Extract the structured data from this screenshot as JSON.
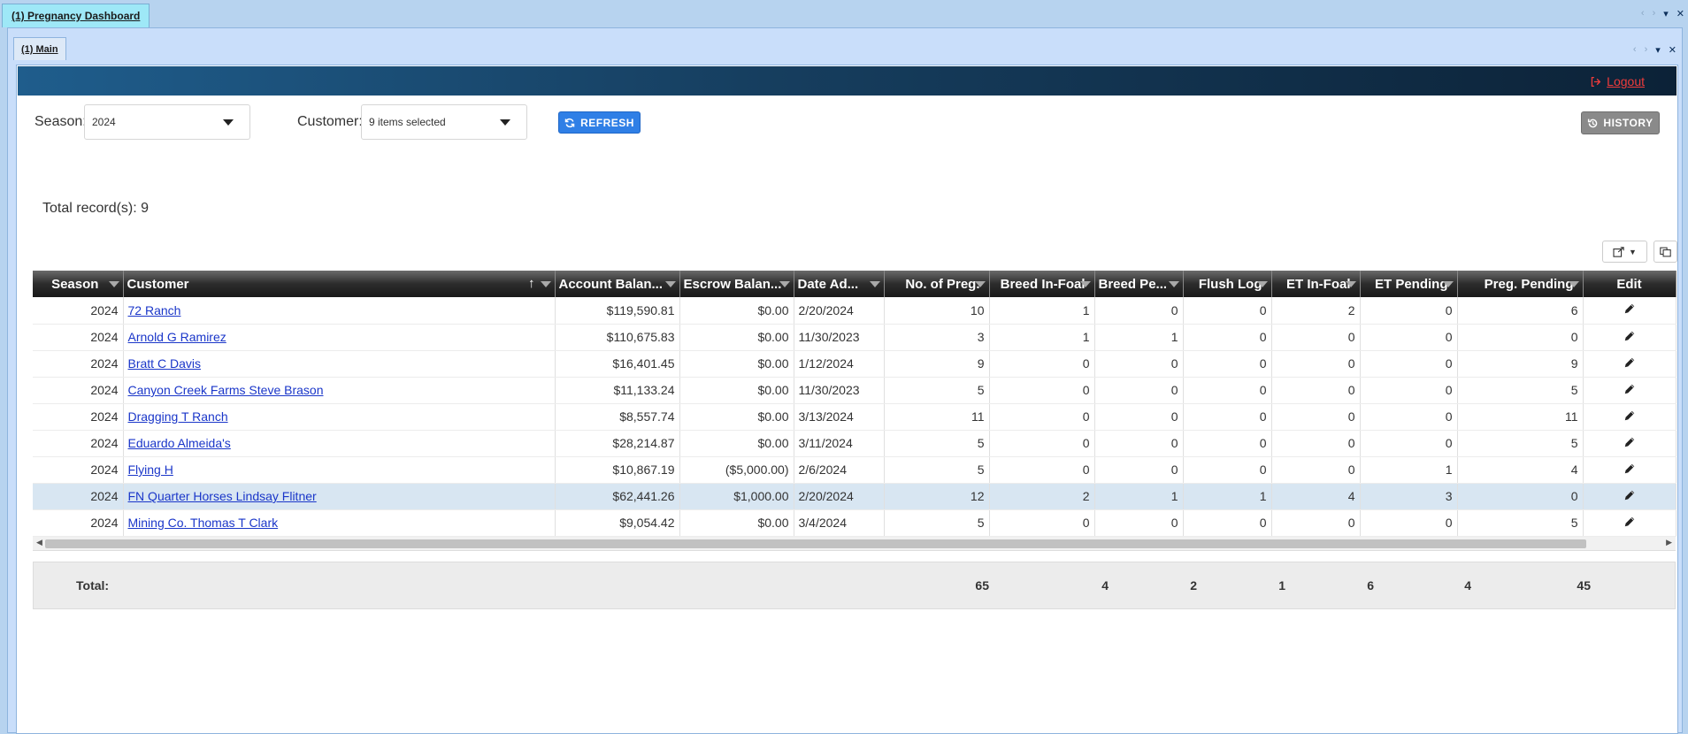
{
  "outer_tab": {
    "label": "(1) Pregnancy Dashboard"
  },
  "inner_tab": {
    "label": "(1) Main"
  },
  "window_controls": {
    "prev": "‹",
    "next": "›",
    "menu": "▾",
    "close": "✕"
  },
  "header": {
    "logout_label": "Logout"
  },
  "filters": {
    "season_label": "Season:",
    "season_value": "2024",
    "customer_label": "Customer:",
    "customer_value": "9 items selected",
    "refresh_label": "REFRESH",
    "history_label": "HISTORY"
  },
  "summary": {
    "total_records": "Total record(s): 9"
  },
  "table": {
    "columns": [
      "Season",
      "Customer",
      "Account Balan...",
      "Escrow Balan...",
      "Date Ad...",
      "No. of Preg.",
      "Breed In-Foal",
      "Breed Pe...",
      "Flush Log",
      "ET In-Foal",
      "ET Pending",
      "Preg. Pending",
      "Edit"
    ],
    "rows": [
      [
        "2024",
        "72 Ranch",
        "$119,590.81",
        "$0.00",
        "2/20/2024",
        "10",
        "1",
        "0",
        "0",
        "2",
        "0",
        "6"
      ],
      [
        "2024",
        "Arnold G Ramirez",
        "$110,675.83",
        "$0.00",
        "11/30/2023",
        "3",
        "1",
        "1",
        "0",
        "0",
        "0",
        "0"
      ],
      [
        "2024",
        "Bratt C Davis",
        "$16,401.45",
        "$0.00",
        "1/12/2024",
        "9",
        "0",
        "0",
        "0",
        "0",
        "0",
        "9"
      ],
      [
        "2024",
        "Canyon Creek Farms Steve Brason",
        "$11,133.24",
        "$0.00",
        "11/30/2023",
        "5",
        "0",
        "0",
        "0",
        "0",
        "0",
        "5"
      ],
      [
        "2024",
        "Dragging T Ranch",
        "$8,557.74",
        "$0.00",
        "3/13/2024",
        "11",
        "0",
        "0",
        "0",
        "0",
        "0",
        "11"
      ],
      [
        "2024",
        "Eduardo Almeida's",
        "$28,214.87",
        "$0.00",
        "3/11/2024",
        "5",
        "0",
        "0",
        "0",
        "0",
        "0",
        "5"
      ],
      [
        "2024",
        "Flying H",
        "$10,867.19",
        "($5,000.00)",
        "2/6/2024",
        "5",
        "0",
        "0",
        "0",
        "0",
        "1",
        "4"
      ],
      [
        "2024",
        "FN Quarter Horses Lindsay Flitner",
        "$62,441.26",
        "$1,000.00",
        "2/20/2024",
        "12",
        "2",
        "1",
        "1",
        "4",
        "3",
        "0"
      ],
      [
        "2024",
        "Mining Co. Thomas T Clark",
        "$9,054.42",
        "$0.00",
        "3/4/2024",
        "5",
        "0",
        "0",
        "0",
        "0",
        "0",
        "5"
      ]
    ],
    "selected_row": 7,
    "edit_icon": "pencil-icon"
  },
  "totals": {
    "label": "Total:",
    "preg": "65",
    "breed_in_foal": "4",
    "breed_pending": "2",
    "flush_log": "1",
    "et_in_foal": "6",
    "et_pending": "4",
    "preg_pending": "45"
  },
  "colors": {
    "link": "#1a36c9",
    "logout": "#ef3b3b",
    "refresh": "#2f7fe6",
    "history": "#8a8a8a",
    "selected_row": "#d8e6f2"
  }
}
